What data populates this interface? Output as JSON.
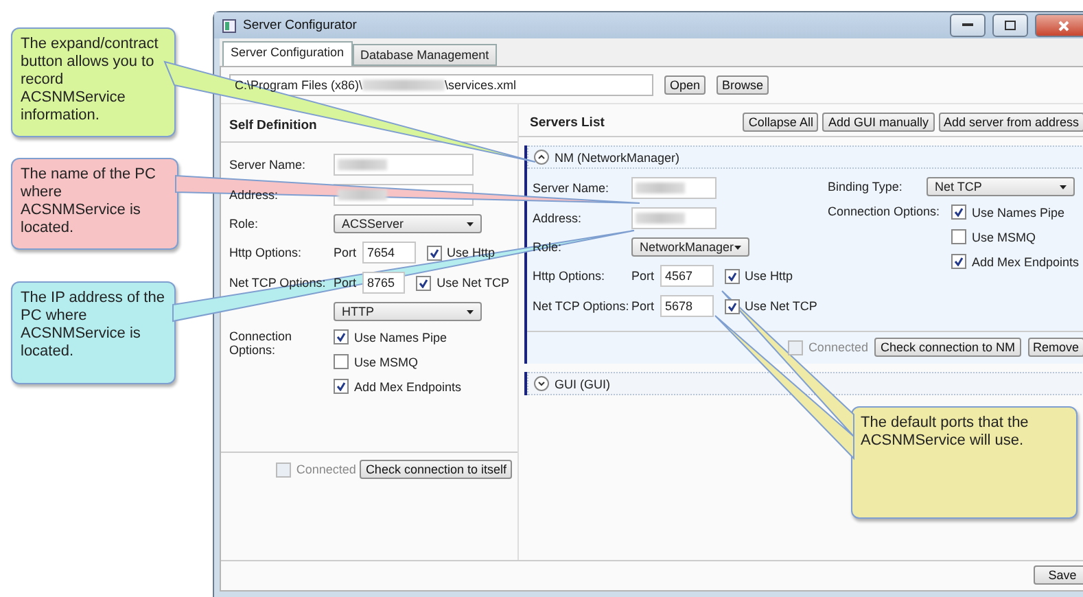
{
  "window": {
    "title": "Server Configurator"
  },
  "tabs": [
    {
      "label": "Server Configuration",
      "selected": true
    },
    {
      "label": "Database Management",
      "selected": false
    }
  ],
  "file": {
    "path_start": "C:\\Program Files (x86)\\",
    "path_end": "\\services.xml",
    "buttons": [
      "Open",
      "Browse"
    ]
  },
  "self_definition": {
    "title": "Self Definition",
    "fields": [
      {
        "kind": "text",
        "label": "Server Name:"
      },
      {
        "kind": "text",
        "label": "Address:"
      },
      {
        "kind": "select",
        "label": "Role:",
        "value": "ACSServer"
      },
      {
        "kind": "port",
        "label": "Http Options:",
        "port_label": "Port",
        "port": "7654",
        "check_label": "Use Http",
        "checked": true
      },
      {
        "kind": "port",
        "label": "Net TCP Options:",
        "port_label": "Port",
        "port": "8765",
        "check_label": "Use Net TCP",
        "checked": true
      },
      {
        "kind": "select",
        "value": "HTTP"
      },
      {
        "kind": "checks",
        "label": "Connection Options:",
        "options": [
          {
            "label": "Use Names Pipe",
            "checked": true
          },
          {
            "label": "Use MSMQ",
            "checked": false
          },
          {
            "label": "Add Mex Endpoints",
            "checked": true
          }
        ]
      }
    ],
    "connected": {
      "label": "Connected",
      "checked": false
    },
    "check_button": "Check connection to itself"
  },
  "servers": {
    "title": "Servers List",
    "buttons": [
      "Collapse All",
      "Add GUI manually",
      "Add server from address"
    ],
    "items": [
      {
        "title": "NM (NetworkManager)",
        "expanded": true,
        "fields": [
          {
            "kind": "text",
            "label": "Server Name:"
          },
          {
            "kind": "text",
            "label": "Address:"
          },
          {
            "kind": "select",
            "label": "Role:",
            "value": "NetworkManager"
          },
          {
            "kind": "port",
            "label": "Http Options:",
            "port_label": "Port",
            "port": "4567",
            "check_label": "Use Http",
            "checked": true
          },
          {
            "kind": "port",
            "label": "Net TCP Options:",
            "port_label": "Port",
            "port": "5678",
            "check_label": "Use Net TCP",
            "checked": true
          }
        ],
        "binding": {
          "label": "Binding Type:",
          "value": "Net TCP"
        },
        "connection": {
          "label": "Connection Options:",
          "options": [
            {
              "label": "Use Names Pipe",
              "checked": true
            },
            {
              "label": "Use MSMQ",
              "checked": false
            },
            {
              "label": "Add Mex Endpoints",
              "checked": true
            }
          ]
        },
        "connected": {
          "label": "Connected",
          "checked": false
        },
        "check_button": "Check connection to NM",
        "remove_button": "Remove"
      },
      {
        "title": "GUI (GUI)",
        "expanded": false
      }
    ]
  },
  "save_button": "Save",
  "callouts": [
    {
      "text": "The expand/contract button allows you to record ACSNMService information.",
      "color": "#d9f59c"
    },
    {
      "text": "The name of the PC where ACSNMService is located.",
      "color": "#f7c3c5"
    },
    {
      "text": "The IP address of the PC where ACSNMService is located.",
      "color": "#b5edef"
    },
    {
      "text": "The default ports that the ACSNMService will use.",
      "color": "#efeaa6"
    }
  ]
}
